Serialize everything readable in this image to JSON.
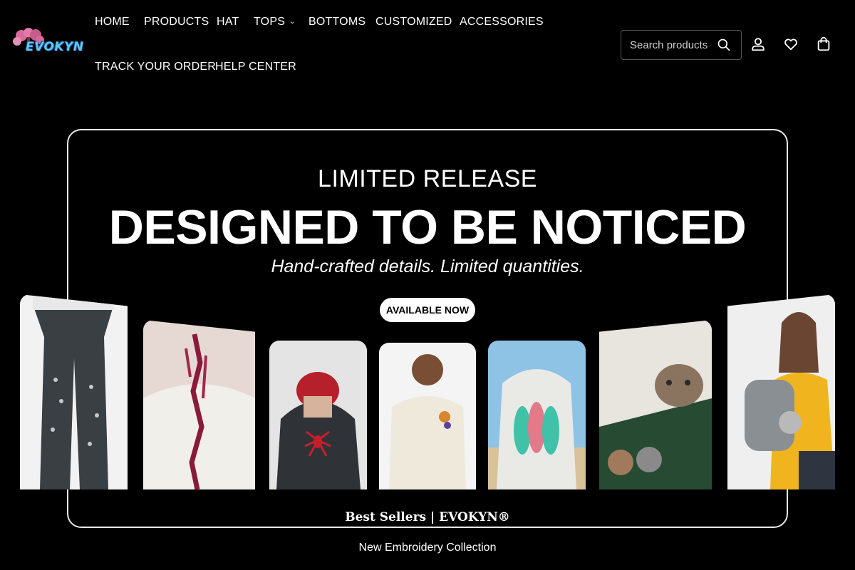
{
  "brand": {
    "logo_text": "EVOKYN"
  },
  "nav": {
    "items": [
      {
        "label": "HOME"
      },
      {
        "label": "PRODUCTS"
      },
      {
        "label": "HAT"
      },
      {
        "label": "TOPS"
      },
      {
        "label": "BOTTOMS"
      },
      {
        "label": "CUSTOMIZED"
      },
      {
        "label": "ACCESSORIES"
      },
      {
        "label": "TRACK YOUR ORDER"
      },
      {
        "label": "HELP CENTER"
      }
    ]
  },
  "search": {
    "placeholder": "Search products"
  },
  "header_icons": [
    "search-icon",
    "account-icon",
    "wishlist-icon",
    "cart-icon"
  ],
  "hero": {
    "eyebrow": "LIMITED RELEASE",
    "title": "DESIGNED TO BE NOTICED",
    "subtitle": "Hand-crafted details. Limited quantities.",
    "cta_label": "AVAILABLE NOW"
  },
  "products": [
    {
      "name": "embroidered-flare-jeans"
    },
    {
      "name": "beaded-drape-top"
    },
    {
      "name": "spider-embroidered-hoodie-and-beanie"
    },
    {
      "name": "cat-embroidered-tee"
    },
    {
      "name": "surfboard-embroidered-hoodie"
    },
    {
      "name": "custom-pet-embroidered-sweatshirt"
    },
    {
      "name": "custom-face-keychain"
    }
  ],
  "section": {
    "title": "Best Sellers | EVOKYN®",
    "subtitle": "New Embroidery Collection"
  },
  "colors": {
    "background": "#000000",
    "text": "#ffffff",
    "cta_bg": "#ffffff",
    "logo_accent": "#5ec8e8"
  }
}
